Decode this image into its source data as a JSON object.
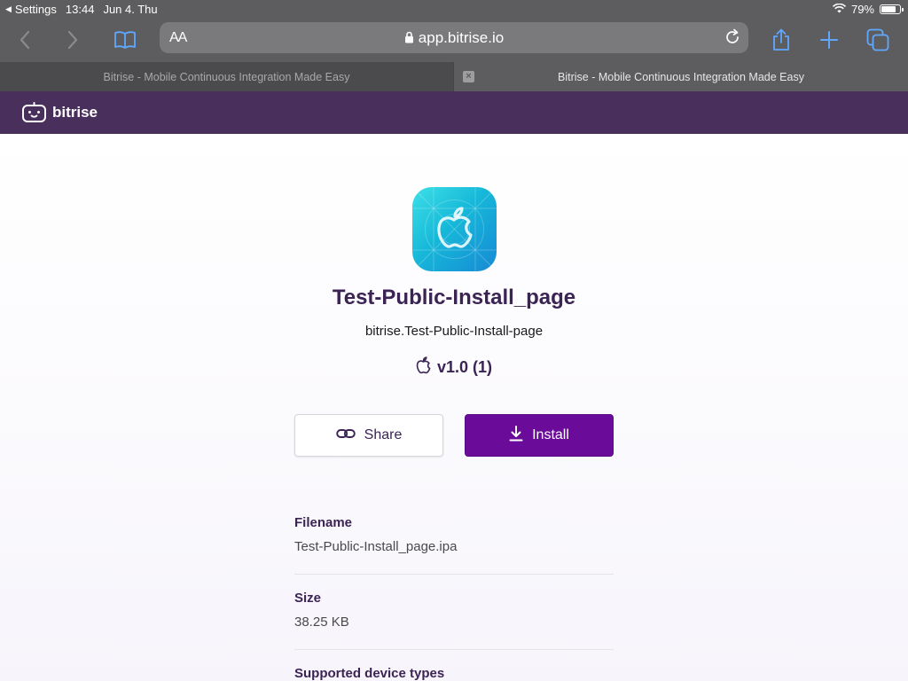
{
  "status_bar": {
    "back_app": "Settings",
    "time": "13:44",
    "date": "Jun 4. Thu",
    "battery": "79%",
    "battery_level": 0.79
  },
  "browser": {
    "text_size_label": "AA",
    "url": "app.bitrise.io",
    "tabs": [
      {
        "title": "Bitrise - Mobile Continuous Integration Made Easy",
        "active": false
      },
      {
        "title": "Bitrise - Mobile Continuous Integration Made Easy",
        "active": true
      }
    ]
  },
  "site": {
    "brand": "bitrise"
  },
  "app": {
    "name": "Test-Public-Install_page",
    "bundle_id": "bitrise.Test-Public-Install-page",
    "version": "v1.0 (1)",
    "platform_icon": "apple-icon"
  },
  "actions": {
    "share_label": "Share",
    "install_label": "Install"
  },
  "details": [
    {
      "label": "Filename",
      "value": "Test-Public-Install_page.ipa"
    },
    {
      "label": "Size",
      "value": "38.25 KB"
    },
    {
      "label": "Supported device types",
      "value": ""
    }
  ],
  "colors": {
    "header_purple": "#492f5c",
    "install_button": "#6a0c99",
    "title_text": "#3b2454",
    "safari_chrome": "#5d5d5f"
  }
}
